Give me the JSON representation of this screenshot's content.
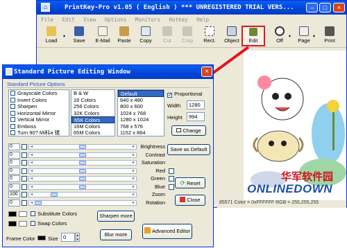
{
  "main": {
    "title": "PrintKey-Pro    v1.05 ( English ) *** UNREGISTERED TRIAL VERS...",
    "menu": [
      "File",
      "Edit",
      "View",
      "Options",
      "Monitors",
      "Hotkey",
      "Help"
    ],
    "toolbar": [
      {
        "label": "Load",
        "icon": "folder-open-icon",
        "disabled": false,
        "dropdown": true
      },
      {
        "label": "Save",
        "icon": "floppy-disk-icon",
        "disabled": false,
        "dropdown": false
      },
      {
        "label": "E-Mail",
        "icon": "envelope-icon",
        "disabled": false,
        "dropdown": false
      },
      {
        "label": "Paste",
        "icon": "clipboard-icon",
        "disabled": false,
        "dropdown": false
      },
      {
        "label": "Copy",
        "icon": "copy-icon",
        "disabled": false,
        "dropdown": false
      },
      {
        "label": "Cut",
        "icon": "scissors-icon",
        "disabled": true,
        "dropdown": false
      },
      {
        "label": "Crop",
        "icon": "crop-icon",
        "disabled": true,
        "dropdown": false
      },
      {
        "label": "Rect.",
        "icon": "rectangle-select-icon",
        "disabled": false,
        "dropdown": false
      },
      {
        "label": "Object",
        "icon": "object-select-icon",
        "disabled": false,
        "dropdown": false
      },
      {
        "label": "Edit",
        "icon": "edit-picture-icon",
        "disabled": false,
        "dropdown": false
      },
      {
        "label": "Off",
        "icon": "timer-icon",
        "disabled": false,
        "dropdown": true
      },
      {
        "label": "Page",
        "icon": "page-setup-icon",
        "disabled": false,
        "dropdown": true
      },
      {
        "label": "Print",
        "icon": "printer-icon",
        "disabled": false,
        "dropdown": false
      }
    ],
    "status": "85571   Color = 0xFFFFFF   RGB = 255,255,255",
    "watermark_cn": "华军软件园",
    "watermark_en": "ONLINEDOWN"
  },
  "dialog": {
    "title": "Standard Picture Editing Window",
    "group_label": "Standard Picture Options",
    "options": [
      "Grayscale Colors",
      "Invert Colors",
      "Sharpen",
      "Horizontal Mirror",
      "Vertical Mirror",
      "Emboss",
      "Turn 90? Mi科a 镜"
    ],
    "color_depths": [
      "B & W",
      "16 Colors",
      "256 Colors",
      "32K Colors",
      "65K Colors",
      "16M Colors",
      "65M Colors"
    ],
    "color_depth_selected": "65K Colors",
    "sizes": [
      "Default",
      "640 x 480",
      "800 x 600",
      "1024 x 768",
      "1280 x 1024",
      "768 x 576",
      "1152 x 864"
    ],
    "size_selected": "Default",
    "proportional_label": "Proportional",
    "proportional_checked": true,
    "width_label": "Width",
    "width_value": "1280",
    "height_label": "Height",
    "height_value": "994",
    "change_label": "Change",
    "save_default_label": "Save as Default",
    "reset_label": "Reset",
    "close_label": "Close",
    "sliders": [
      {
        "label": "Brightness",
        "value": "0",
        "level": 0.5
      },
      {
        "label": "Contrast",
        "value": "0",
        "level": 0.5
      },
      {
        "label": "Saturation",
        "value": "0",
        "level": 0.5
      },
      {
        "label": "Red",
        "value": "0",
        "level": 0.5,
        "rgb_check": true
      },
      {
        "label": "Green",
        "value": "0",
        "level": 0.5,
        "rgb_check": true
      },
      {
        "label": "Blue",
        "value": "0",
        "level": 0.5,
        "rgb_check": true
      },
      {
        "label": "Zoom",
        "value": "100",
        "level": 0.18
      },
      {
        "label": "Rotation",
        "value": "0",
        "level": 0.0
      }
    ],
    "substitute_label": "Substitute Colors",
    "swap_label": "Swap Colors",
    "sharpen_more_label": "Sharpen more",
    "blur_more_label": "Blur more",
    "advanced_label": "Advanced Editor",
    "frame_color_label": "Frame Color",
    "size_label": "Size",
    "size_value": "0"
  },
  "colors": {
    "title_blue": "#0a5ef0",
    "selection": "#316ac5",
    "callout_red": "#e3161b",
    "watermark_blue": "#1e4fa8",
    "watermark_red": "#d20f1e"
  }
}
